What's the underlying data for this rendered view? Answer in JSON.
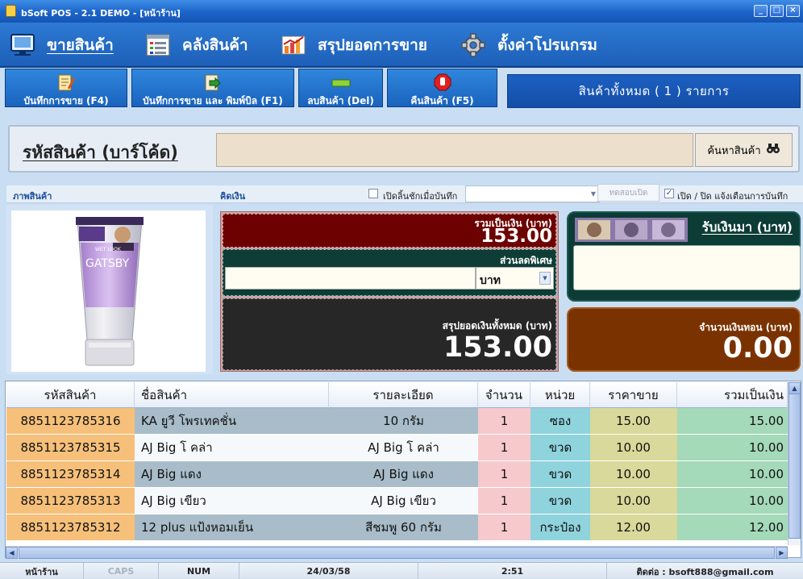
{
  "window": {
    "title": "bSoft POS - 2.1 DEMO - [หน้าร้าน]"
  },
  "menu": [
    {
      "label": "ขายสินค้า",
      "icon": "monitor-icon"
    },
    {
      "label": "คลังสินค้า",
      "icon": "inventory-list-icon"
    },
    {
      "label": "สรุปยอดการขาย",
      "icon": "sales-chart-icon"
    },
    {
      "label": "ตั้งค่าโปรแกรม",
      "icon": "gear-icon"
    }
  ],
  "toolbar": {
    "save": "บันทึกการขาย (F4)",
    "save_print": "บันทึกการขาย และ พิมพ์บิล (F1)",
    "delete": "ลบสินค้า (Del)",
    "return": "คืนสินค้า (F5)",
    "total_count": "สินค้าทั้งหมด ( 1 ) รายการ"
  },
  "barcode": {
    "label": "รหัสสินค้า (บาร์โค้ด)",
    "value": "",
    "search_label": "ค้นหาสินค้า"
  },
  "options": {
    "product_image_label": "ภาพสินค้า",
    "checkout_label": "คิดเงิน",
    "open_drawer_label": "เปิดลิ้นชักเมื่อบันทึก",
    "open_drawer_checked": false,
    "drawer_select_value": "",
    "test_open_label": "ทดสอบเปิด",
    "notify_label": "เปิด / ปิด แจ้งเตือนการบันทึก",
    "notify_checked": true
  },
  "product_image": {
    "brand": "GATSBY",
    "subtext": "WET LOOK"
  },
  "payment": {
    "subtotal_label": "รวมเป็นเงิน (บาท)",
    "subtotal_value": "153.00",
    "discount_label": "ส่วนลดพิเศษ",
    "discount_value": "",
    "discount_unit": "บาท",
    "grand_total_label": "สรุปยอดเงินทั้งหมด (บาท)",
    "grand_total_value": "153.00",
    "cash_received_label": "รับเงินมา (บาท)",
    "cash_received_value": "",
    "change_label": "จำนวนเงินทอน (บาท)",
    "change_value": "0.00"
  },
  "table": {
    "headers": [
      "รหัสสินค้า",
      "ชื่อสินค้า",
      "รายละเอียด",
      "จำนวน",
      "หน่วย",
      "ราคาขาย",
      "รวมเป็นเงิน"
    ],
    "rows": [
      [
        "8851123785316",
        "KA ยูวี โพรเทคชั่น",
        "10 กรัม",
        "1",
        "ซอง",
        "15.00",
        "15.00"
      ],
      [
        "8851123785315",
        "AJ Big โ คล่า",
        "AJ Big โ คล่า",
        "1",
        "ขวด",
        "10.00",
        "10.00"
      ],
      [
        "8851123785314",
        "AJ Big แดง",
        "AJ Big แดง",
        "1",
        "ขวด",
        "10.00",
        "10.00"
      ],
      [
        "8851123785313",
        "AJ Big เขียว",
        "AJ Big เขียว",
        "1",
        "ขวด",
        "10.00",
        "10.00"
      ],
      [
        "8851123785312",
        "12 plus แป้งหอมเย็น",
        "สีชมพู 60 กรัม",
        "1",
        "กระป๋อง",
        "12.00",
        "12.00"
      ]
    ]
  },
  "status": {
    "screen": "หน้าร้าน",
    "caps": "CAPS",
    "num": "NUM",
    "date": "24/03/58",
    "time": "2:51",
    "contact": "ติดต่อ : bsoft888@gmail.com"
  },
  "colors": {
    "brand_blue": "#1d64c4",
    "subtotal_bg": "#6d0000",
    "discount_bg": "#0d3d36",
    "change_bg": "#7a3300"
  }
}
